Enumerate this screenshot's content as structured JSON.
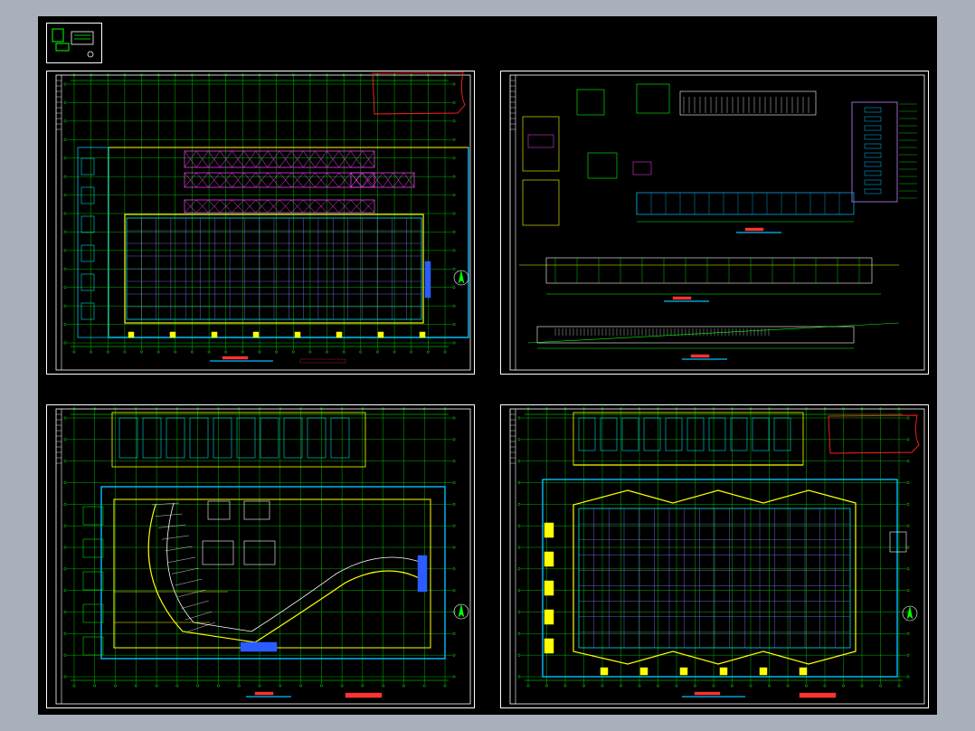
{
  "window": {
    "background": "#a9b0bb",
    "canvas_background": "#000000"
  },
  "colors": {
    "border": "#ffffff",
    "grid": "#00ff00",
    "column_grid": "#00ffff",
    "wall": "#ffff00",
    "outline": "#00bfff",
    "parking": "#ff44ff",
    "blue_fill": "#2a5cff",
    "markup": "#ff2020",
    "dim_red": "#ff3333"
  },
  "thumbnail": {
    "icon": "drawing-thumbnail-icon"
  },
  "sheets": [
    {
      "id": "sheet-1",
      "icon": "floor-plan-icon",
      "markup": true
    },
    {
      "id": "sheet-2",
      "icon": "elevation-section-icon",
      "markup": false
    },
    {
      "id": "sheet-3",
      "icon": "site-plan-icon",
      "markup": false
    },
    {
      "id": "sheet-4",
      "icon": "floor-plan-icon",
      "markup": true
    }
  ]
}
